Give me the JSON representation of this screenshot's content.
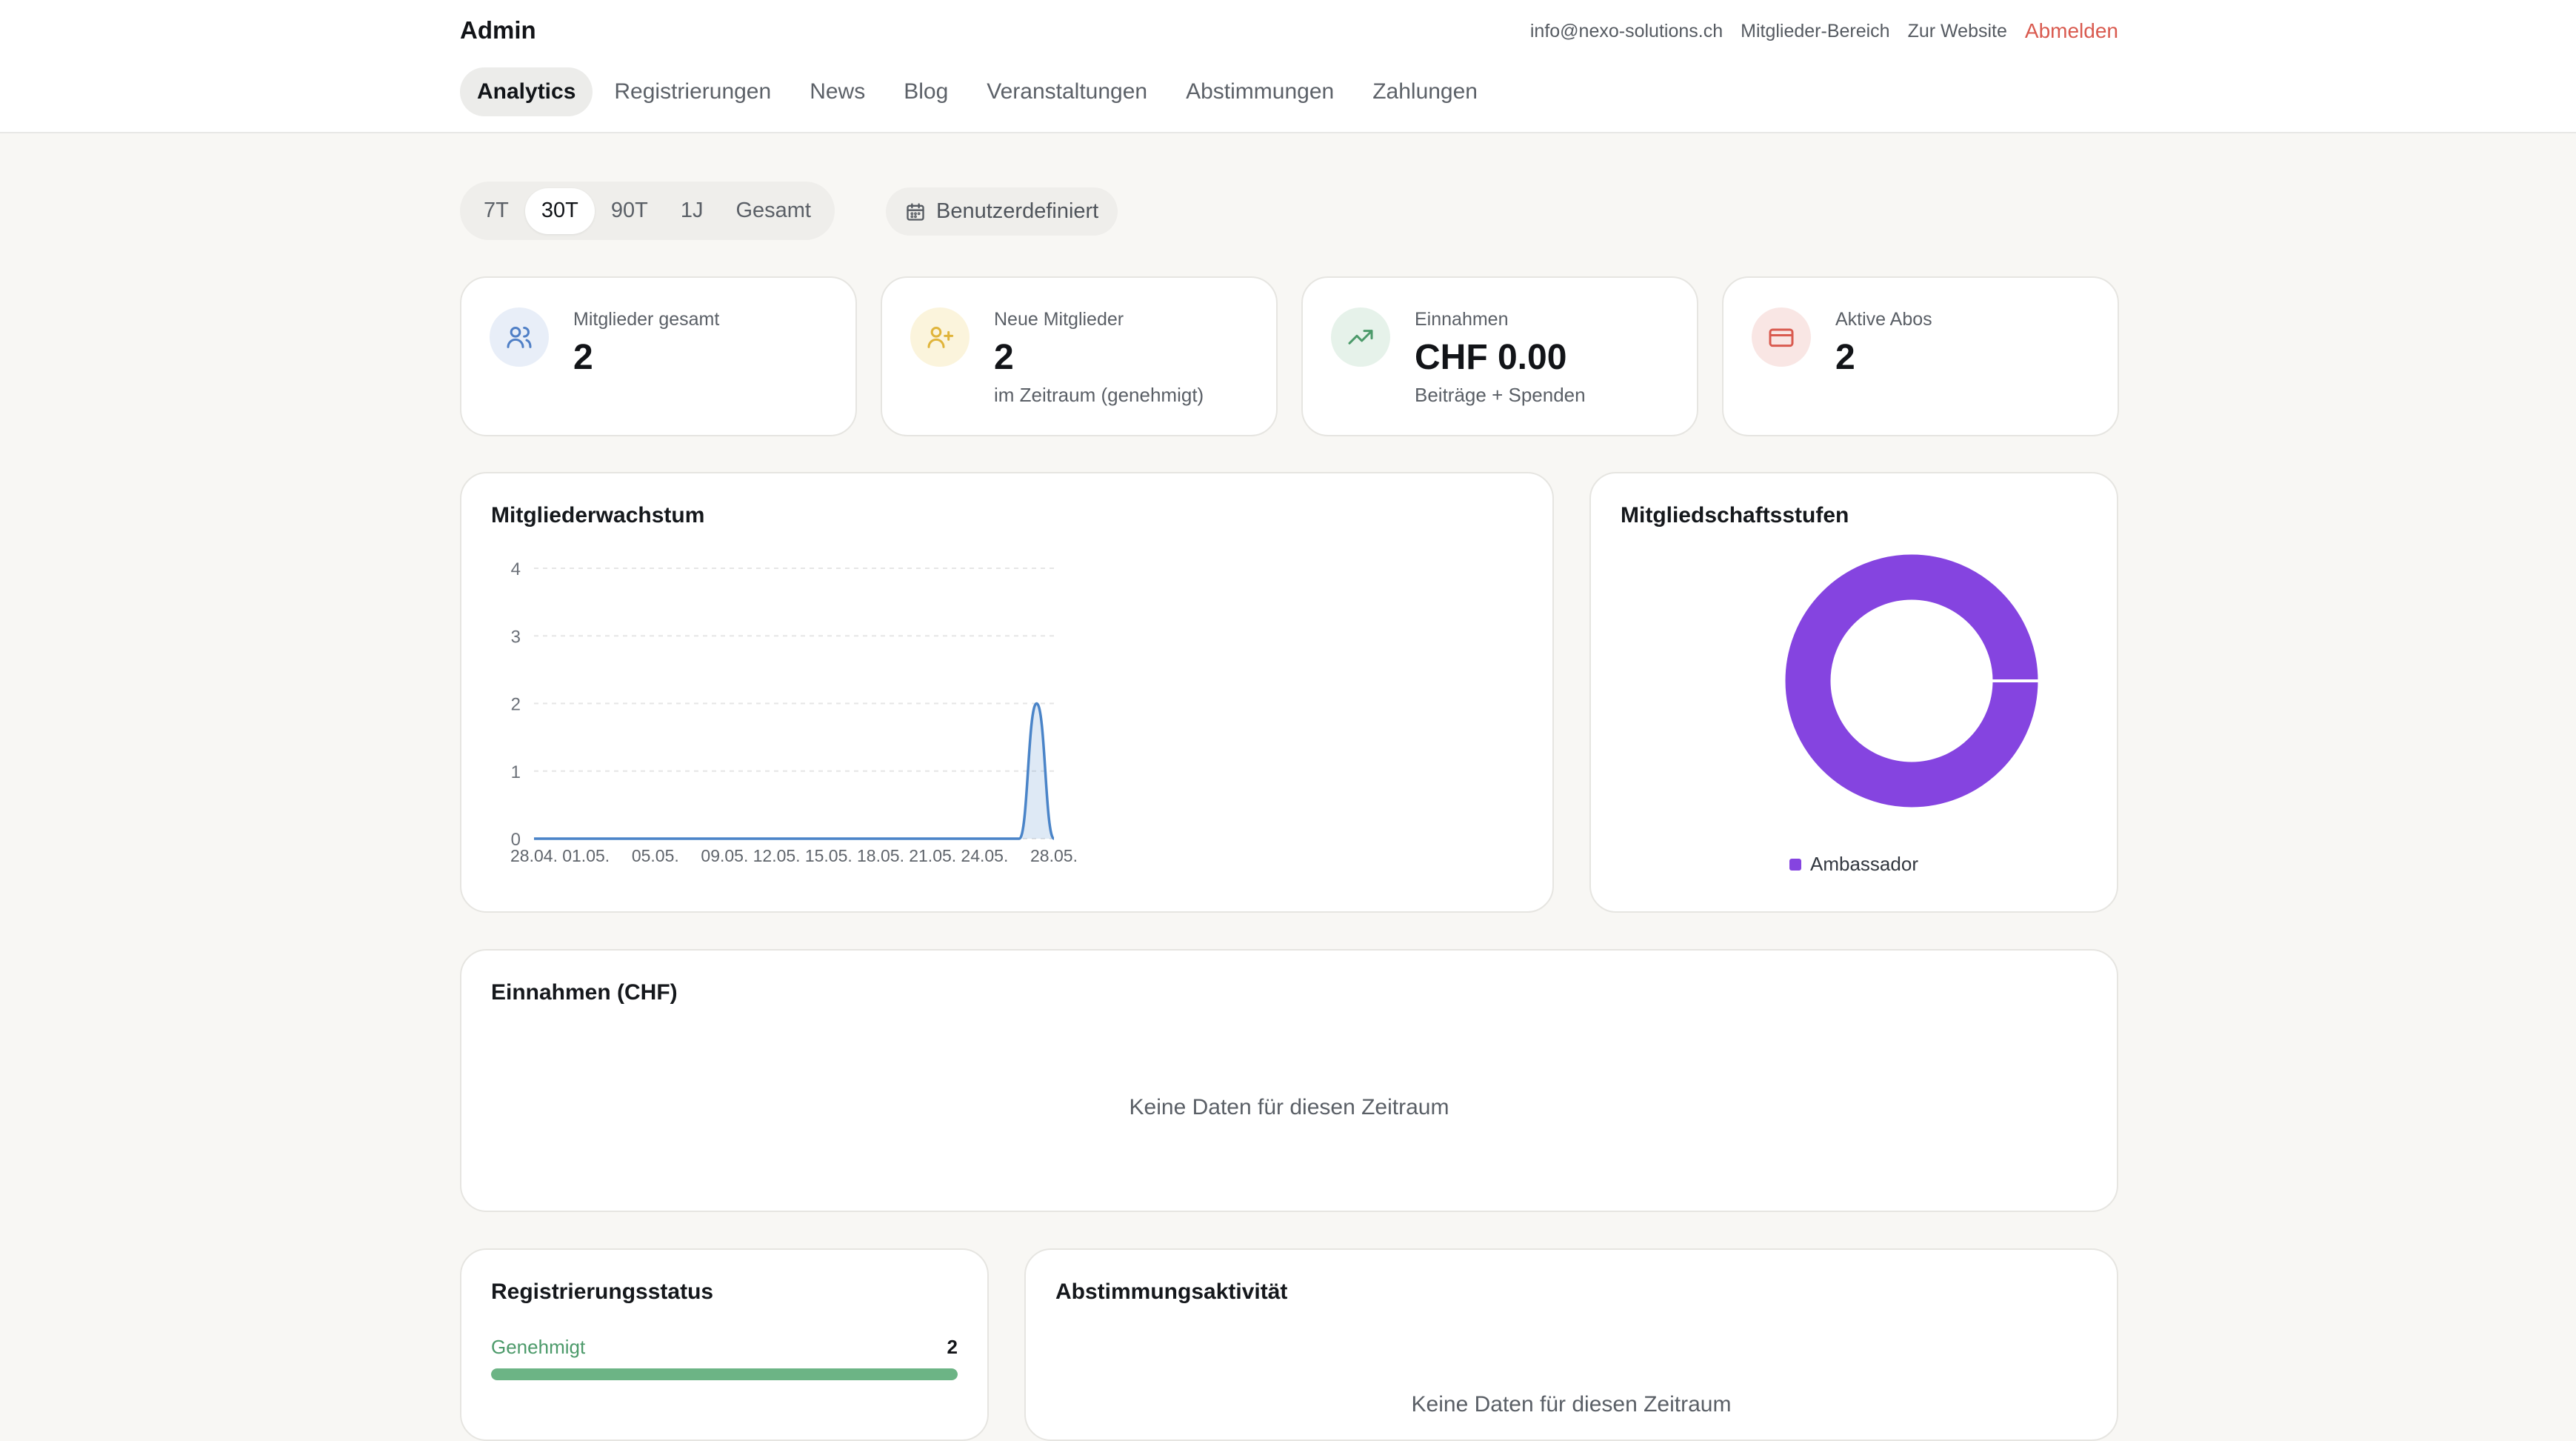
{
  "header": {
    "brand": "Admin",
    "email": "info@nexo-solutions.ch",
    "members_area": "Mitglieder-Bereich",
    "website": "Zur Website",
    "logout": "Abmelden"
  },
  "nav": {
    "items": [
      {
        "label": "Analytics",
        "active": true
      },
      {
        "label": "Registrierungen"
      },
      {
        "label": "News"
      },
      {
        "label": "Blog"
      },
      {
        "label": "Veranstaltungen"
      },
      {
        "label": "Abstimmungen"
      },
      {
        "label": "Zahlungen"
      }
    ]
  },
  "range": {
    "options": [
      "7T",
      "30T",
      "90T",
      "1J",
      "Gesamt"
    ],
    "selected": "30T",
    "custom_label": "Benutzerdefiniert"
  },
  "kpis": [
    {
      "label": "Mitglieder gesamt",
      "value": "2",
      "sub": "",
      "icon": "users-icon",
      "color": "#4f7fc6"
    },
    {
      "label": "Neue Mitglieder",
      "value": "2",
      "sub": "im Zeitraum (genehmigt)",
      "icon": "user-plus-icon",
      "color": "#e0b43a"
    },
    {
      "label": "Einnahmen",
      "value": "CHF 0.00",
      "sub": "Beiträge + Spenden",
      "icon": "trending-up-icon",
      "color": "#4c9a6a"
    },
    {
      "label": "Aktive Abos",
      "value": "2",
      "sub": "",
      "icon": "credit-card-icon",
      "color": "#d95a4f"
    }
  ],
  "growth": {
    "title": "Mitgliederwachstum"
  },
  "tiers": {
    "title": "Mitgliedschaftsstufen",
    "legend": "Ambassador"
  },
  "revenue": {
    "title": "Einnahmen (CHF)",
    "empty": "Keine Daten für diesen Zeitraum"
  },
  "registration": {
    "title": "Registrierungsstatus",
    "status_label": "Genehmigt",
    "status_count": "2",
    "fill_fraction": 1.0
  },
  "votes": {
    "title": "Abstimmungsaktivität",
    "empty": "Keine Daten für diesen Zeitraum"
  },
  "chart_data": [
    {
      "type": "area",
      "title": "Mitgliederwachstum",
      "x_ticks": [
        "28.04.",
        "01.05.",
        "05.05.",
        "09.05.",
        "12.05.",
        "15.05.",
        "18.05.",
        "21.05.",
        "24.05.",
        "28.05."
      ],
      "x": [
        "28.04.",
        "29.04.",
        "30.04.",
        "01.05.",
        "02.05.",
        "03.05.",
        "04.05.",
        "05.05.",
        "06.05.",
        "07.05.",
        "08.05.",
        "09.05.",
        "10.05.",
        "11.05.",
        "12.05.",
        "13.05.",
        "14.05.",
        "15.05.",
        "16.05.",
        "17.05.",
        "18.05.",
        "19.05.",
        "20.05.",
        "21.05.",
        "22.05.",
        "23.05.",
        "24.05.",
        "25.05.",
        "26.05.",
        "27.05.",
        "28.05."
      ],
      "series": [
        {
          "values": [
            0,
            0,
            0,
            0,
            0,
            0,
            0,
            0,
            0,
            0,
            0,
            0,
            0,
            0,
            0,
            0,
            0,
            0,
            0,
            0,
            0,
            0,
            0,
            0,
            0,
            0,
            0,
            0,
            0,
            2,
            0
          ]
        }
      ],
      "y_ticks": [
        0,
        1,
        2,
        3,
        4
      ],
      "ylim": [
        0,
        4
      ],
      "grid": true
    },
    {
      "type": "pie",
      "title": "Mitgliedschaftsstufen",
      "categories": [
        "Ambassador"
      ],
      "values": [
        2
      ],
      "colors": [
        "#8544e0"
      ],
      "legend": "bottom"
    }
  ]
}
